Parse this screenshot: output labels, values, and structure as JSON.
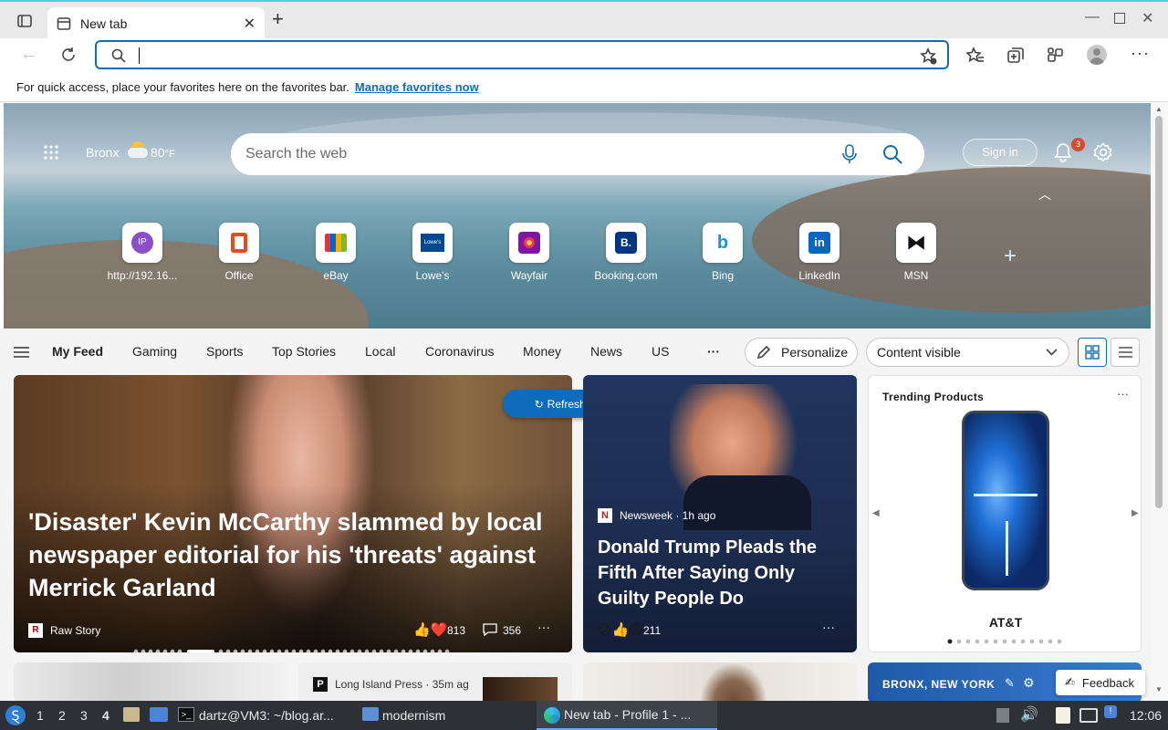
{
  "browser": {
    "tab_title": "New tab",
    "address_value": "",
    "favbar_text": "For quick access, place your favorites here on the favorites bar.",
    "favbar_link": "Manage favorites now"
  },
  "hero": {
    "location": "Bronx",
    "temp": "80",
    "temp_unit": "°F",
    "search_placeholder": "Search the web",
    "sign_in": "Sign in",
    "notification_count": "3",
    "tiles": [
      {
        "label": "http://192.16...",
        "icon": "ip-icon",
        "glyph": "IP"
      },
      {
        "label": "Office",
        "icon": "office-icon",
        "glyph": ""
      },
      {
        "label": "eBay",
        "icon": "ebay-icon",
        "glyph": ""
      },
      {
        "label": "Lowe's",
        "icon": "lowes-icon",
        "glyph": "Lowe's"
      },
      {
        "label": "Wayfair",
        "icon": "wayfair-icon",
        "glyph": ""
      },
      {
        "label": "Booking.com",
        "icon": "booking-icon",
        "glyph": "B."
      },
      {
        "label": "Bing",
        "icon": "bing-icon",
        "glyph": "b"
      },
      {
        "label": "LinkedIn",
        "icon": "linkedin-icon",
        "glyph": "in"
      },
      {
        "label": "MSN",
        "icon": "msn-icon",
        "glyph": ""
      }
    ]
  },
  "nav": {
    "items": [
      "My Feed",
      "Gaming",
      "Sports",
      "Top Stories",
      "Local",
      "Coronavirus",
      "Money",
      "News",
      "US"
    ],
    "more": "···",
    "personalize": "Personalize",
    "content_select": "Content visible"
  },
  "feed": {
    "refresh": "Refresh stories",
    "main_story": {
      "headline": "'Disaster' Kevin McCarthy slammed by local newspaper editorial for his 'threats' against Merrick Garland",
      "source": "Raw Story",
      "reactions": "813",
      "comments": "356"
    },
    "second_story": {
      "source": "Newsweek · 1h ago",
      "headline": "Donald Trump Pleads the Fifth After Saying Only Guilty People Do",
      "reactions": "211"
    },
    "trending": {
      "title": "Trending Products",
      "product": "AT&T"
    },
    "bottom": {
      "source": "Long Island Press · 35m ag",
      "weather": "BRONX, NEW YORK",
      "feedback": "Feedback"
    }
  },
  "taskbar": {
    "workspaces": [
      "1",
      "2",
      "3",
      "4"
    ],
    "terminal": "dartz@VM3: ~/blog.ar...",
    "folder": "modernism",
    "browser": "New tab - Profile 1 - ...",
    "clock": "12:06"
  },
  "colors": {
    "accent": "#0f6cbd",
    "taskbar": "#2d3136",
    "badge": "#d74a2a"
  }
}
